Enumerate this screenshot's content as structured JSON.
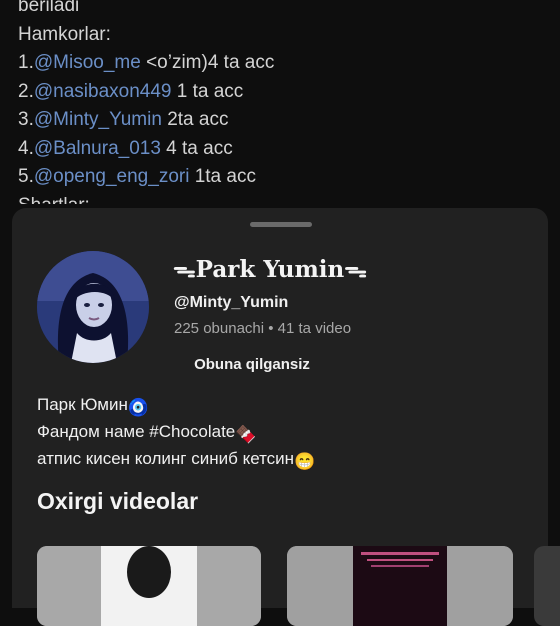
{
  "post": {
    "lines": [
      {
        "text": "beriladi"
      },
      {
        "text": "Hamkorlar:"
      },
      {
        "num": "1.",
        "mention": "@Misoo_me",
        "rest": " <o’zim)4 ta acc"
      },
      {
        "num": "2.",
        "mention": "@nasibaxon449",
        "rest": " 1 ta acc"
      },
      {
        "num": "3.",
        "mention": "@Minty_Yumin",
        "rest": " 2ta acc"
      },
      {
        "num": "4.",
        "mention": "@Balnura_013",
        "rest": "  4 ta acc"
      },
      {
        "num": "5.",
        "mention": "@openg_eng_zori",
        "rest": " 1ta acc"
      },
      {
        "text": "Shartlar:"
      }
    ]
  },
  "channel": {
    "name": "ᯓPark Yuminᯓ",
    "handle": "@Minty_Yumin",
    "stats": "225 obunachi • 41 ta video",
    "subscribe_label": "Obuna qilgansiz",
    "bio": [
      {
        "text": "Парк Юмин",
        "emoji": "🧿"
      },
      {
        "text": "Фандом наме #Chocolate",
        "emoji": "🍫"
      },
      {
        "text": "атпис кисен колинг синиб кетсин",
        "emoji": "😁"
      }
    ],
    "recent_title": "Oxirgi videolar"
  },
  "colors": {
    "background": "#0e0e0e",
    "sheet": "#212121",
    "mention": "#6b8fc7",
    "secondary_text": "#a8a8a8"
  }
}
